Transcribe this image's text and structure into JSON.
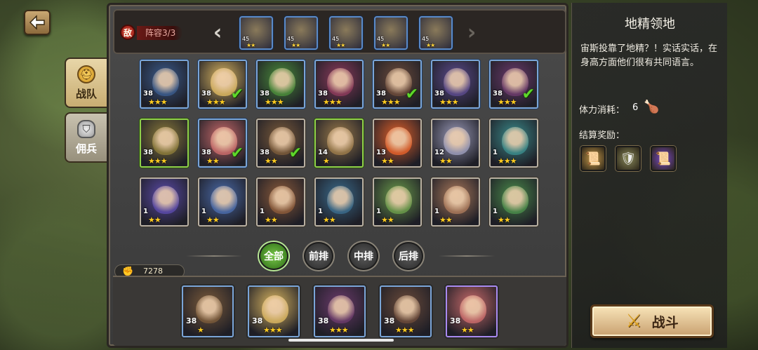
{
  "colors": {
    "accent_green": "#5ed82a",
    "star": "#ffcc20",
    "enemy_red": "#c42a1e",
    "panel_dark": "#3a3a3a"
  },
  "nav": {
    "back_icon": "back-arrow-icon"
  },
  "side_tabs": [
    {
      "label": "战队",
      "icon": "helmet-icon",
      "active": true
    },
    {
      "label": "佣兵",
      "icon": "knight-helmet-icon",
      "active": false
    }
  ],
  "enemy": {
    "badge": "敌",
    "formation_label": "阵容3/3",
    "units": [
      {
        "level": "45",
        "stars": "★★"
      },
      {
        "level": "45",
        "stars": "★★"
      },
      {
        "level": "45",
        "stars": "★★"
      },
      {
        "level": "45",
        "stars": "★★"
      },
      {
        "level": "45",
        "stars": "★★"
      }
    ]
  },
  "heroes": [
    {
      "level": "38",
      "stars": "★★★",
      "selected": false,
      "frame": "blue",
      "color": "#3a5a8a"
    },
    {
      "level": "38",
      "stars": "★★★",
      "selected": true,
      "frame": "blue",
      "color": "#d8b460"
    },
    {
      "level": "38",
      "stars": "★★★",
      "selected": false,
      "frame": "blue",
      "color": "#4a8a3a"
    },
    {
      "level": "38",
      "stars": "★★★",
      "selected": false,
      "frame": "blue",
      "color": "#8a3a5a"
    },
    {
      "level": "38",
      "stars": "★★★",
      "selected": true,
      "frame": "blue",
      "color": "#6a4a3a"
    },
    {
      "level": "38",
      "stars": "★★★",
      "selected": false,
      "frame": "blue",
      "color": "#5a4a8a"
    },
    {
      "level": "38",
      "stars": "★★★",
      "selected": true,
      "frame": "blue",
      "color": "#6a3a6a"
    },
    {
      "level": "38",
      "stars": "★★★",
      "selected": false,
      "frame": "green",
      "color": "#8a7a3a"
    },
    {
      "level": "38",
      "stars": "★★",
      "selected": true,
      "frame": "blue",
      "color": "#c86a6a"
    },
    {
      "level": "38",
      "stars": "★★",
      "selected": true,
      "frame": "gray",
      "color": "#7a5a3a"
    },
    {
      "level": "14",
      "stars": "★",
      "selected": false,
      "frame": "green",
      "color": "#9a7a4a"
    },
    {
      "level": "13",
      "stars": "★★",
      "selected": false,
      "frame": "gray",
      "color": "#e0602a"
    },
    {
      "level": "12",
      "stars": "★★",
      "selected": false,
      "frame": "gray",
      "color": "#9a9ab8"
    },
    {
      "level": "1",
      "stars": "★★★",
      "selected": false,
      "frame": "gray",
      "color": "#3a8a8a"
    },
    {
      "level": "1",
      "stars": "★★",
      "selected": false,
      "frame": "gray",
      "color": "#5a4aa8"
    },
    {
      "level": "1",
      "stars": "★★",
      "selected": false,
      "frame": "gray",
      "color": "#4a6aa8"
    },
    {
      "level": "1",
      "stars": "★★",
      "selected": false,
      "frame": "gray",
      "color": "#8a5a3a"
    },
    {
      "level": "1",
      "stars": "★★",
      "selected": false,
      "frame": "gray",
      "color": "#3a6a8a"
    },
    {
      "level": "1",
      "stars": "★★",
      "selected": false,
      "frame": "gray",
      "color": "#6a9a4a"
    },
    {
      "level": "1",
      "stars": "★★",
      "selected": false,
      "frame": "gray",
      "color": "#a8785a"
    },
    {
      "level": "1",
      "stars": "★★",
      "selected": false,
      "frame": "gray",
      "color": "#4a8a4a"
    }
  ],
  "filters": [
    {
      "label": "全部",
      "active": true
    },
    {
      "label": "前排",
      "active": false
    },
    {
      "label": "中排",
      "active": false
    },
    {
      "label": "后排",
      "active": false
    }
  ],
  "power": {
    "icon": "fist-icon",
    "value": "7278"
  },
  "lineup": [
    {
      "level": "38",
      "stars": "★",
      "frame": "blue",
      "color": "#7a5a3a"
    },
    {
      "level": "38",
      "stars": "★★★",
      "frame": "blue",
      "color": "#d8b460"
    },
    {
      "level": "38",
      "stars": "★★★",
      "frame": "blue",
      "color": "#6a3a6a"
    },
    {
      "level": "38",
      "stars": "★★★",
      "frame": "blue",
      "color": "#6a4a3a"
    },
    {
      "level": "38",
      "stars": "★★",
      "frame": "purple",
      "color": "#c86a6a"
    }
  ],
  "info": {
    "title": "地精领地",
    "description": "宙斯投靠了地精？！实话实话，在身高方面他们很有共同语言。",
    "stamina_label": "体力消耗：",
    "stamina_value": "6",
    "stamina_icon": "drumstick-icon",
    "reward_label": "结算奖励：",
    "rewards": [
      {
        "icon": "scroll-gold-icon",
        "color": "#c89a4a"
      },
      {
        "icon": "shield-badge-icon",
        "color": "#8a8a5a"
      },
      {
        "icon": "purple-scroll-icon",
        "color": "#7a4ac8"
      }
    ]
  },
  "fight_button": {
    "label": "战斗",
    "icon": "crossed-swords-icon"
  }
}
